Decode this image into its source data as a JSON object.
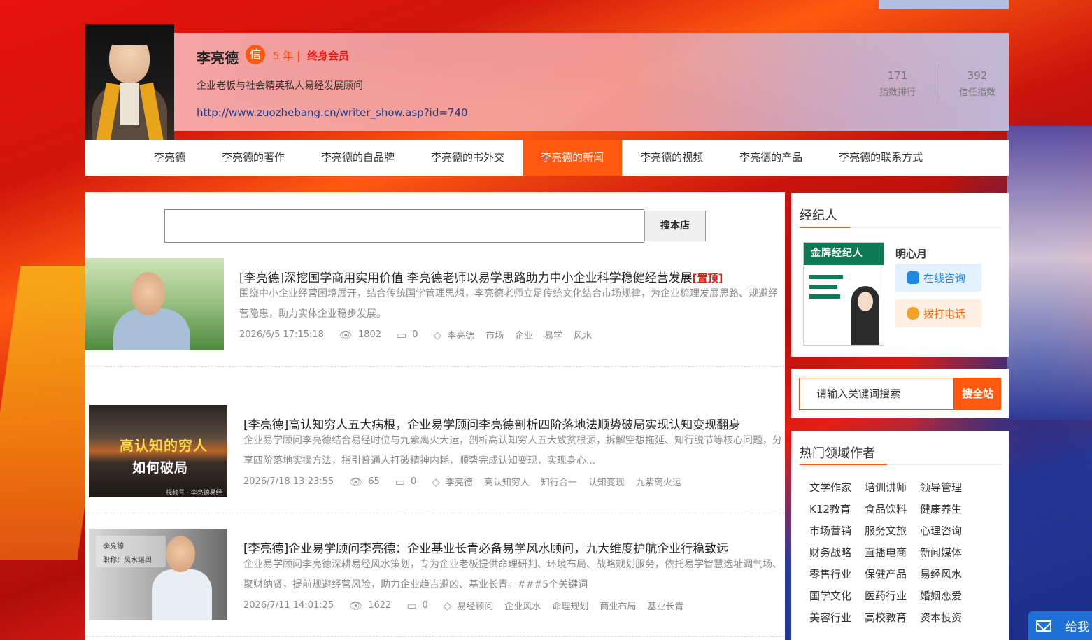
{
  "writer": {
    "name": "李亮德",
    "badge": "信",
    "years": "5 年 |",
    "membership": "终身会员",
    "bio": "企业老板与社会精英私人易经发展顾问",
    "homepage": "http://www.zuozhebang.cn/writer_show.asp?id=740",
    "stats": [
      {
        "value": "171",
        "label": "指数排行"
      },
      {
        "value": "392",
        "label": "信任指数"
      }
    ]
  },
  "nav": {
    "items": [
      "李亮德",
      "李亮德的著作",
      "李亮德的自品牌",
      "李亮德的书外交",
      "李亮德的新闻",
      "李亮德的视频",
      "李亮德的产品",
      "李亮德的联系方式"
    ],
    "active": "李亮德的新闻"
  },
  "shop_search": {
    "value": "",
    "button": "搜本店"
  },
  "articles": [
    {
      "title": "[李亮德]深挖国学商用实用价值 李亮德老师以易学思路助力中小企业科学稳健经营发展",
      "pin": "[置顶]",
      "summary": "围绕中小企业经营困境展开，结合传统国学管理思想，李亮德老师立足传统文化结合市场规律，为企业梳理发展思路、规避经营隐患，助力实体企业稳步发展。",
      "date": "2026/6/5 17:15:18",
      "views": "1802",
      "comments": "0",
      "tags": [
        "李亮德",
        "市场",
        "企业",
        "易学",
        "风水"
      ]
    },
    {
      "title": "[李亮德]高认知穷人五大病根，企业易学顾问李亮德剖析四阶落地法顺势破局实现认知变现翻身",
      "pin": "",
      "summary": "企业易学顾问李亮德结合易经时位与九紫离火大运，剖析高认知穷人五大致贫根源，拆解空想拖延、知行脱节等核心问题，分享四阶落地实操方法，指引普通人打破精神内耗，顺势完成认知变现，实现身心...",
      "date": "2026/7/18 13:23:55",
      "views": "65",
      "comments": "0",
      "tags": [
        "李亮德",
        "高认知穷人",
        "知行合一",
        "认知变现",
        "九紫离火运"
      ],
      "thumb_text": [
        "高认知的穷人",
        "如何破局"
      ],
      "thumb_caption": "视频号 · 李亮德易经国学智慧"
    },
    {
      "title": "[李亮德]企业易学顾问李亮德：企业基业长青必备易学风水顾问，九大维度护航企业行稳致远",
      "pin": "",
      "summary": "企业易学顾问李亮德深耕易经风水策划，专为企业老板提供命理研判、环境布局、战略规划服务，依托易学智慧选址调气场、聚财纳贤，提前规避经营风险，助力企业趋吉避凶、基业长青。###5个关键词",
      "date": "2026/7/11 14:01:25",
      "views": "1622",
      "comments": "0",
      "tags": [
        "易经顾问",
        "企业风水",
        "命理规划",
        "商业布局",
        "基业长青"
      ],
      "thumb_text": [
        "李亮德",
        "职称：风水堪舆"
      ]
    }
  ],
  "agent": {
    "section_title": "经纪人",
    "poster_title": "金牌经纪人",
    "name": "明心月",
    "online_btn": "在线咨询",
    "call_btn": "拨打电话"
  },
  "site_search": {
    "placeholder": "请输入关键词搜索",
    "button": "搜全站"
  },
  "hot_authors": {
    "title": "热门领域作者",
    "items": [
      "文学作家",
      "培训讲师",
      "领导管理",
      "K12教育",
      "食品饮料",
      "健康养生",
      "市场营销",
      "服务文旅",
      "心理咨询",
      "财务战略",
      "直播电商",
      "新闻媒体",
      "零售行业",
      "保健产品",
      "易经风水",
      "国学文化",
      "医药行业",
      "婚姻恋爱",
      "美容行业",
      "高校教育",
      "资本投资"
    ]
  },
  "feedback": {
    "label": "给我"
  },
  "colors": {
    "accent": "#ff5a0f",
    "pin": "#e6180e",
    "link": "#1a3c8c"
  }
}
